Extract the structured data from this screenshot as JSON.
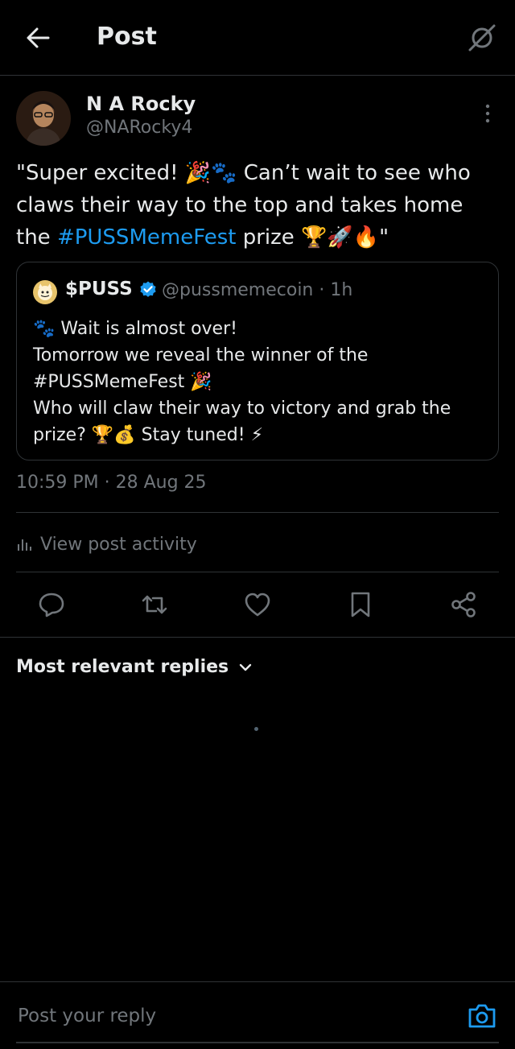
{
  "header": {
    "title": "Post"
  },
  "post": {
    "author_name": "N A Rocky",
    "author_handle": "@NARocky4",
    "text_line1": "\"Super excited! 🎉🐾 Can’t wait to see who",
    "text_line2": "claws their way to the top and takes home",
    "text_line3_prefix": "the ",
    "hashtag": "#PUSSMemeFest",
    "text_line3_suffix": " prize 🏆🚀🔥\"",
    "timestamp": "10:59 PM · 28 Aug 25"
  },
  "quote": {
    "name": "$PUSS",
    "handle_time": "@pussmemecoin · 1h",
    "lines": [
      "🐾 Wait is almost over!",
      "Tomorrow we reveal the winner of the",
      "#PUSSMemeFest 🎉",
      "Who will claw their way to victory and grab the",
      "prize? 🏆💰 Stay tuned! ⚡"
    ]
  },
  "activity": {
    "label": "View post activity"
  },
  "replies": {
    "heading": "Most relevant replies"
  },
  "reply_bar": {
    "placeholder": "Post your reply"
  },
  "colors": {
    "background": "#000000",
    "text": "#e7e9ea",
    "secondary_text": "#71767b",
    "accent": "#1d9bf0",
    "border": "#2f3336"
  },
  "icons": {
    "back": "arrow-left-icon",
    "grok": "grok-icon",
    "more": "more-vertical-icon",
    "verified": "verified-badge-icon",
    "activity": "bar-chart-icon",
    "reply": "reply-icon",
    "repost": "repost-icon",
    "like": "heart-icon",
    "bookmark": "bookmark-icon",
    "share": "share-icon",
    "chevron": "chevron-down-icon",
    "camera": "camera-icon"
  }
}
